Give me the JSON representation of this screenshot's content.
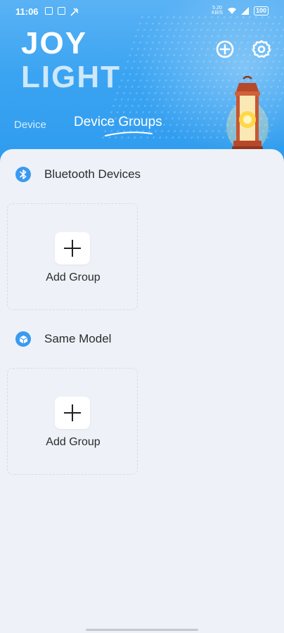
{
  "status_bar": {
    "time": "11:06",
    "speed_value": "5.20",
    "speed_unit": "KB/S",
    "battery": "100"
  },
  "header": {
    "logo_line1": "JOY",
    "logo_line2": "LIGHT",
    "tabs": [
      {
        "label": "Device",
        "selected": false
      },
      {
        "label": "Device Groups",
        "selected": true
      }
    ]
  },
  "sections": [
    {
      "title": "Bluetooth Devices",
      "icon": "bluetooth-icon",
      "card": {
        "label": "Add Group"
      }
    },
    {
      "title": "Same Model",
      "icon": "cube-icon",
      "card": {
        "label": "Add Group"
      }
    }
  ],
  "colors": {
    "header_blue": "#3aa4f2",
    "icon_blue": "#3b9af0",
    "background": "#eef2f8"
  }
}
